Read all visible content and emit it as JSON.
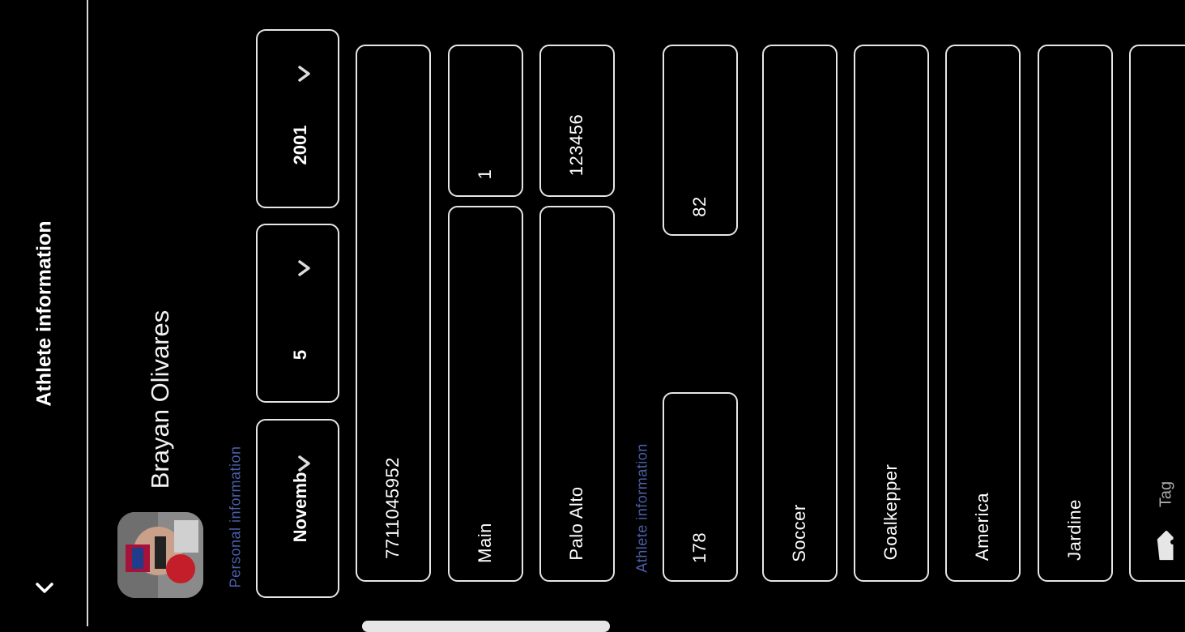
{
  "header": {
    "title": "Athlete information",
    "back_icon": "chevron-down-icon"
  },
  "profile": {
    "name": "Brayan Olivares"
  },
  "personal_section": {
    "label": "Personal information",
    "birth_month": "Novemb",
    "birth_day": "5",
    "birth_year": "2001",
    "phone": "7711045952",
    "street": "Main",
    "street_number": "1",
    "city": "Palo Alto",
    "postal_code": "123456"
  },
  "athlete_section": {
    "label": "Athlete information",
    "height": "178",
    "weight": "82",
    "sport": "Soccer",
    "position": "Goalkepper",
    "team": "America",
    "club": "Jardine",
    "tag_placeholder": "Tag"
  },
  "colors": {
    "background": "#000000",
    "section_label": "#4a5fa8",
    "border": "#e6e6e6"
  }
}
